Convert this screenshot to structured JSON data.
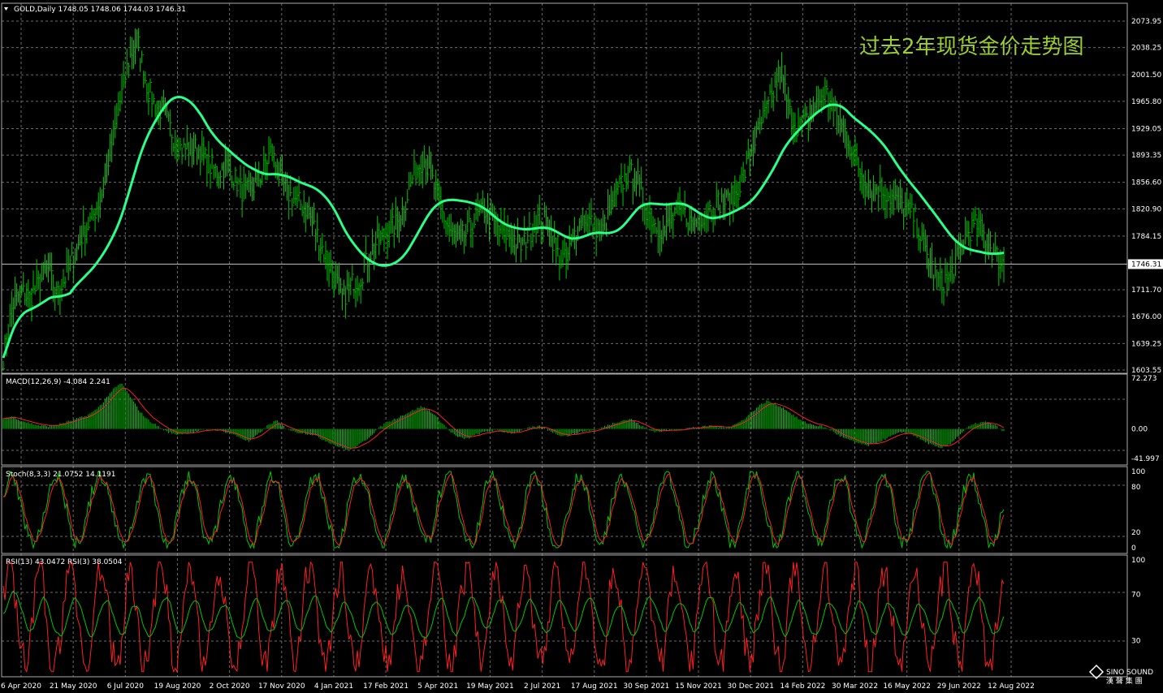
{
  "header": {
    "symbol_info": "GOLD,Daily  1748.05 1748.06 1744.03 1746.31",
    "overlay_title": "过去2年现货金价走势图"
  },
  "logo": {
    "line1": "SINO SOUND",
    "line2": "漢 聲 集 團"
  },
  "colors": {
    "bars": "#00c800",
    "ma": "#2aff8a",
    "signal": "#ff2020",
    "rsi_fast": "#ff2020",
    "rsi_slow": "#00c800",
    "grid": "#6b6b6b"
  },
  "chart_data": [
    {
      "type": "bar",
      "name": "price",
      "price_ticks": [
        "2073.95",
        "2038.25",
        "2001.50",
        "1965.80",
        "1929.05",
        "1893.35",
        "1856.60",
        "1820.90",
        "1784.15",
        "1746.31",
        "1711.70",
        "1676.00",
        "1639.25",
        "1603.55"
      ],
      "ylim": [
        1603.55,
        2073.95
      ],
      "current_price": 1746.31,
      "x_ticks": [
        "6 Apr 2020",
        "21 May 2020",
        "6 Jul 2020",
        "19 Aug 2020",
        "2 Oct 2020",
        "17 Nov 2020",
        "4 Jan 2021",
        "17 Feb 2021",
        "5 Apr 2021",
        "19 May 2021",
        "2 Jul 2021",
        "17 Aug 2021",
        "30 Sep 2021",
        "15 Nov 2021",
        "30 Dec 2021",
        "14 Feb 2022",
        "30 Mar 2022",
        "16 May 2022",
        "29 Jun 2022",
        "12 Aug 2022"
      ],
      "close_approx": [
        1620,
        1690,
        1710,
        1700,
        1720,
        1740,
        1705,
        1730,
        1760,
        1790,
        1810,
        1840,
        1900,
        1960,
        2020,
        2050,
        1990,
        1960,
        1950,
        1920,
        1900,
        1905,
        1900,
        1880,
        1870,
        1880,
        1860,
        1840,
        1850,
        1870,
        1900,
        1860,
        1840,
        1830,
        1820,
        1790,
        1760,
        1730,
        1700,
        1720,
        1730,
        1760,
        1780,
        1790,
        1800,
        1830,
        1870,
        1890,
        1860,
        1820,
        1790,
        1780,
        1790,
        1810,
        1820,
        1800,
        1790,
        1780,
        1770,
        1790,
        1810,
        1800,
        1760,
        1750,
        1790,
        1810,
        1800,
        1790,
        1820,
        1850,
        1870,
        1860,
        1820,
        1800,
        1790,
        1810,
        1820,
        1800,
        1810,
        1820,
        1830,
        1830,
        1840,
        1870,
        1910,
        1940,
        1970,
        2010,
        1950,
        1930,
        1940,
        1960,
        1980,
        1950,
        1930,
        1900,
        1870,
        1850,
        1850,
        1840,
        1830,
        1820,
        1810,
        1770,
        1740,
        1720,
        1730,
        1760,
        1790,
        1800,
        1780,
        1760,
        1746
      ]
    },
    {
      "type": "line",
      "name": "MACD",
      "label": "MACD(12,26,9) -4.084 2.241",
      "ticks": [
        "72.273",
        "0.00",
        "-41.997"
      ],
      "ylim": [
        -41.997,
        72.273
      ],
      "values_approx": [
        15,
        18,
        12,
        8,
        5,
        4,
        6,
        10,
        14,
        18,
        25,
        38,
        55,
        65,
        45,
        25,
        12,
        4,
        -4,
        -8,
        -6,
        -4,
        -2,
        0,
        -3,
        -6,
        -12,
        -18,
        -8,
        4,
        12,
        2,
        -4,
        -6,
        -8,
        -14,
        -20,
        -26,
        -30,
        -24,
        -14,
        -2,
        8,
        14,
        20,
        26,
        32,
        25,
        12,
        -2,
        -12,
        -14,
        -8,
        -4,
        -2,
        -4,
        -6,
        -2,
        2,
        4,
        -2,
        -8,
        -10,
        -6,
        -3,
        -2,
        3,
        8,
        12,
        14,
        6,
        -2,
        -4,
        -2,
        -1,
        1,
        2,
        3,
        5,
        2,
        4,
        10,
        20,
        32,
        40,
        35,
        28,
        18,
        10,
        6,
        4,
        -2,
        -10,
        -16,
        -20,
        -24,
        -20,
        -14,
        -8,
        -4,
        -8,
        -16,
        -22,
        -28,
        -22,
        -10,
        2,
        8,
        10,
        6,
        -4
      ]
    },
    {
      "type": "line",
      "name": "Stoch",
      "label": "Stoch(8,3,3) 21.0752 14.1191",
      "ticks": [
        "100",
        "80",
        "20",
        "0"
      ],
      "ylim": [
        0,
        100
      ]
    },
    {
      "type": "line",
      "name": "RSI",
      "label": "RSI(13) 43.0472  RSI(3) 38.0504",
      "ticks": [
        "100",
        "70",
        "30"
      ],
      "ylim": [
        0,
        100
      ]
    }
  ]
}
